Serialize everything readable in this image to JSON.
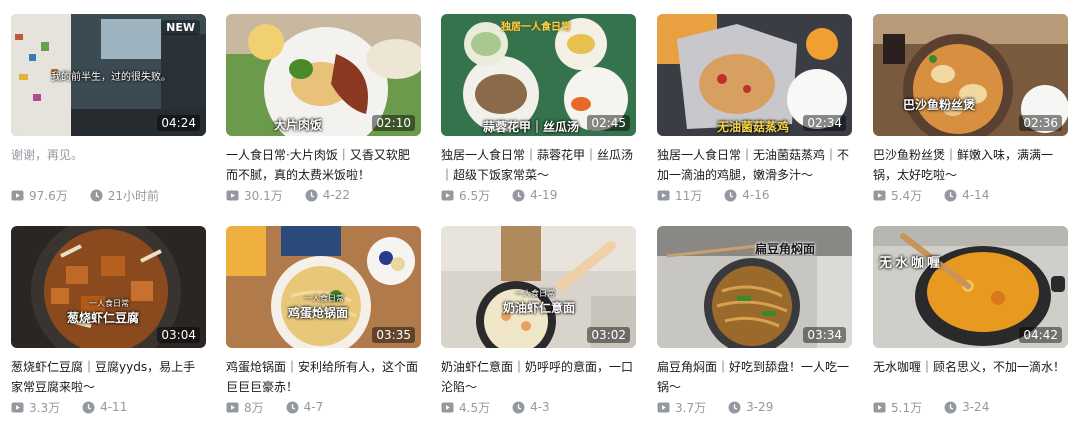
{
  "videos": [
    {
      "title": "谢谢，再见。",
      "plays": "97.6万",
      "date": "21小时前",
      "duration": "04:24",
      "badge": "NEW",
      "overlay_text": "我的前半生，过的很失败。",
      "title_muted": true
    },
    {
      "title": "一人食日常·大片肉饭｜又香又软肥而不腻，真的太费米饭啦！",
      "plays": "30.1万",
      "date": "4-22",
      "duration": "02:10",
      "overlay_text": "大片肉饭"
    },
    {
      "title": "独居一人食日常｜蒜蓉花甲｜丝瓜汤｜超级下饭家常菜～",
      "plays": "6.5万",
      "date": "4-19",
      "duration": "02:45",
      "overlay_text": "蒜蓉花甲｜丝瓜汤",
      "overlay_text_top": "独居一人食日常"
    },
    {
      "title": "独居一人食日常｜无油菌菇蒸鸡｜不加一滴油的鸡腿，嫩滑多汁～",
      "plays": "11万",
      "date": "4-16",
      "duration": "02:34",
      "overlay_text": "无油菌菇蒸鸡"
    },
    {
      "title": "巴沙鱼粉丝煲｜鲜嫩入味，满满一锅，太好吃啦～",
      "plays": "5.4万",
      "date": "4-14",
      "duration": "02:36",
      "overlay_text": "巴沙鱼粉丝煲"
    },
    {
      "title": "葱烧虾仁豆腐｜豆腐yyds，易上手家常豆腐来啦～",
      "plays": "3.3万",
      "date": "4-11",
      "duration": "03:04",
      "overlay_text": "葱烧虾仁豆腐",
      "overlay_text_small": "一人食日常"
    },
    {
      "title": "鸡蛋炝锅面｜安利给所有人，这个面巨巨巨豪赤！",
      "plays": "8万",
      "date": "4-7",
      "duration": "03:35",
      "overlay_text": "鸡蛋炝锅面",
      "overlay_text_small": "一人食日常"
    },
    {
      "title": "奶油虾仁意面｜奶呼呼的意面，一口沦陷～",
      "plays": "4.5万",
      "date": "4-3",
      "duration": "03:02",
      "overlay_text": "奶油虾仁意面",
      "overlay_text_small": "一人食日常"
    },
    {
      "title": "扁豆角焖面｜好吃到舔盘！一人吃一锅～",
      "plays": "3.7万",
      "date": "3-29",
      "duration": "03:34",
      "overlay_text": "扁豆角焖面"
    },
    {
      "title": "无水咖喱｜顾名思义，不加一滴水！",
      "plays": "5.1万",
      "date": "3-24",
      "duration": "04:42",
      "overlay_text": "无水咖喱"
    }
  ],
  "colors": {
    "text": "#18191c",
    "muted": "#9499a0",
    "icon": "#9499a0"
  }
}
